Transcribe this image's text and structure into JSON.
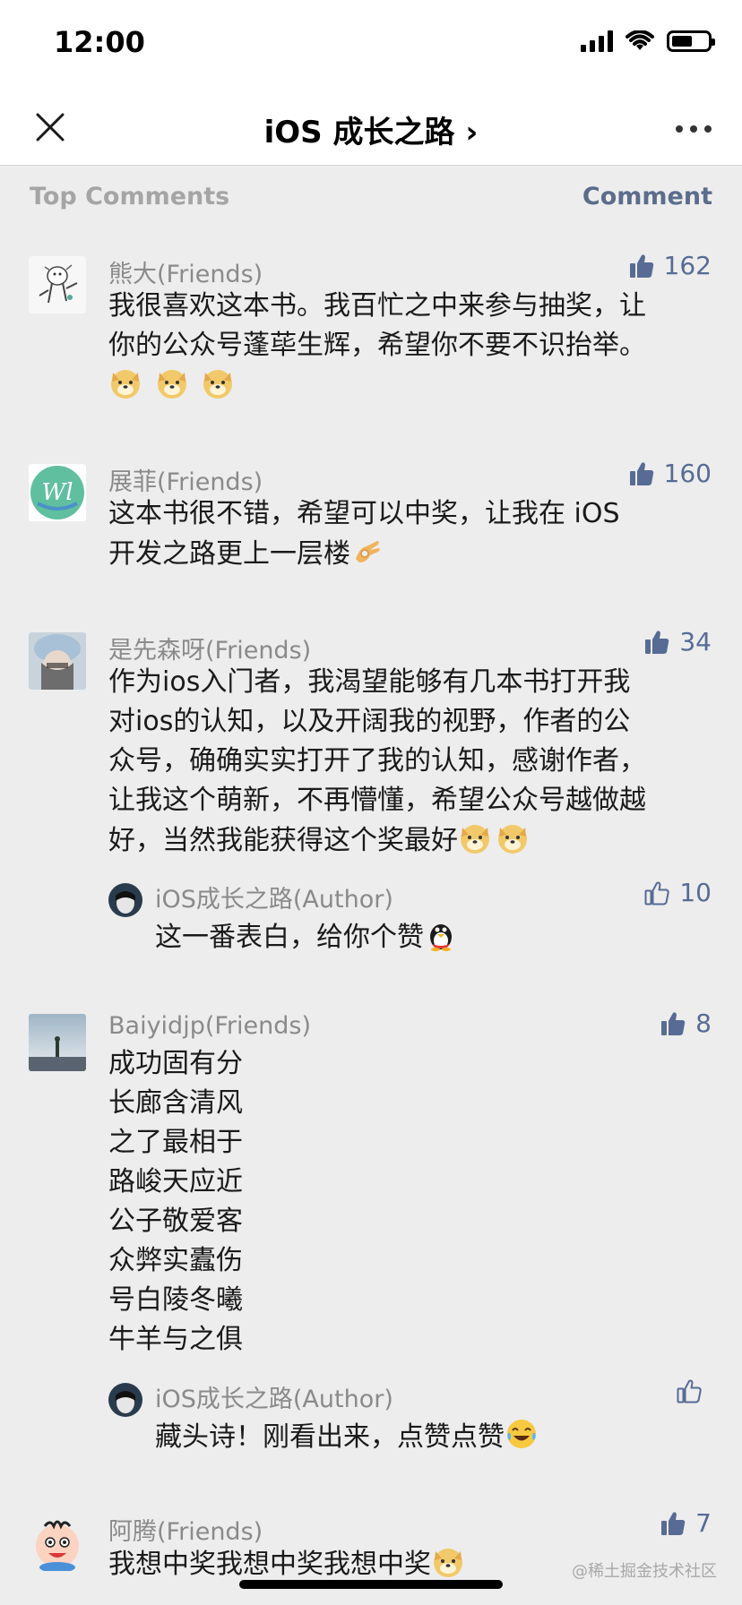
{
  "status": {
    "time": "12:00"
  },
  "nav": {
    "title": "iOS 成长之路 ›"
  },
  "header": {
    "section_title": "Top Comments",
    "comment_link": "Comment"
  },
  "colors": {
    "accent": "#576b95",
    "background": "#ededed",
    "meta_text": "#8a8a8a"
  },
  "comments": [
    {
      "name": "熊大(Friends)",
      "likes": "162",
      "lines": [
        "我很喜欢这本书。我百忙之中来参与抽奖，让",
        "你的公众号蓬荜生辉，希望你不要不识抬举。"
      ],
      "emoji": [
        "doge-emoji",
        "doge-emoji",
        "doge-emoji"
      ]
    },
    {
      "name": "展菲(Friends)",
      "likes": "160",
      "lines": [
        "这本书很不错，希望可以中奖，让我在 iOS",
        "开发之路更上一层楼"
      ],
      "emoji": [
        "ok-hand-emoji"
      ]
    },
    {
      "name": "是先森呀(Friends)",
      "likes": "34",
      "lines": [
        "作为ios入门者，我渴望能够有几本书打开我",
        "对ios的认知，以及开阔我的视野，作者的公",
        "众号，确确实实打开了我的认知，感谢作者，",
        "让我这个萌新，不再懵懂，希望公众号越做越",
        "好，当然我能获得这个奖最好"
      ],
      "emoji": [
        "doge-emoji",
        "doge-emoji"
      ],
      "reply": {
        "name": "iOS成长之路(Author)",
        "likes": "10",
        "text": "这一番表白，给你个赞",
        "emoji": "penguin-emoji"
      }
    },
    {
      "name": "Baiyidjp(Friends)",
      "likes": "8",
      "lines": [
        "成功固有分",
        "长廊含清风",
        "之了最相于",
        "路峻天应近",
        "公子敬爱客",
        "众弊实蠹伤",
        "号白陵冬曦",
        "牛羊与之俱"
      ],
      "reply": {
        "name": "iOS成长之路(Author)",
        "likes": "",
        "text": "藏头诗！刚看出来，点赞点赞",
        "emoji": "laughing-emoji"
      }
    },
    {
      "name": "阿腾(Friends)",
      "likes": "7",
      "lines": [
        "我想中奖我想中奖我想中奖"
      ],
      "emoji": [
        "doge-emoji"
      ]
    }
  ],
  "watermark": "@稀土掘金技术社区"
}
